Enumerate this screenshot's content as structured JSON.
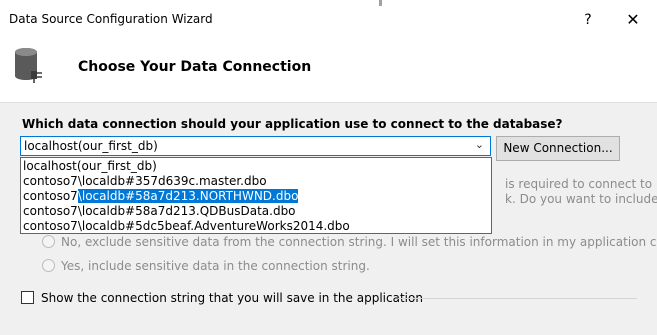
{
  "window": {
    "title": "Data Source Configuration Wizard",
    "help_glyph": "?",
    "close_glyph": "✕"
  },
  "header": {
    "icon": "database-connect-icon",
    "title": "Choose Your Data Connection"
  },
  "connection": {
    "question": "Which data connection should your application use to connect to the database?",
    "selected_value": "localhost(our_first_db)",
    "new_connection_label": "New Connection...",
    "options": [
      {
        "label": "localhost(our_first_db)"
      },
      {
        "label": "contoso7\\localdb#357d639c.master.dbo"
      },
      {
        "prefix": "contoso7",
        "highlight": "\\localdb#58a7d213.NORTHWND.dbo"
      },
      {
        "label": "contoso7\\localdb#58a7d213.QDBusData.dbo"
      },
      {
        "label": "contoso7\\localdb#5dc5beaf.AdventureWorks2014.dbo"
      }
    ]
  },
  "sensitive": {
    "behind_line1": "is required to connect to",
    "behind_line2": "k. Do you want to include",
    "option_no": "No, exclude sensitive data from the connection string. I will set this information in my application code.",
    "option_yes": "Yes, include sensitive data in the connection string."
  },
  "show_string": {
    "label": "Show the connection string that you will save in the application"
  },
  "colors": {
    "accent": "#0078d7",
    "dialog_bg": "#f0f0f0",
    "disabled_text": "#8c8c8c"
  }
}
